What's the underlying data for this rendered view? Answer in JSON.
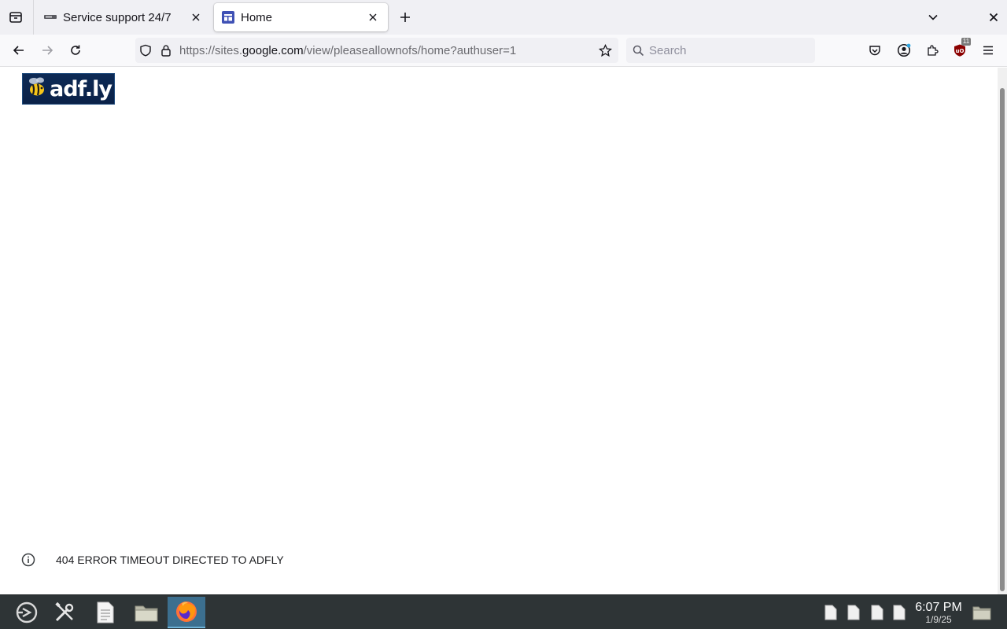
{
  "browser": {
    "tabs": [
      {
        "title": "Service support 24/7",
        "active": false,
        "favicon": "gray-bar-icon"
      },
      {
        "title": "Home",
        "active": true,
        "favicon": "google-sites-icon"
      }
    ],
    "url": {
      "prefix": "https://sites.",
      "domain": "google.com",
      "suffix": "/view/pleaseallownofs/home?authuser=1"
    },
    "search_placeholder": "Search",
    "extension_badge": "11"
  },
  "page": {
    "logo_text": "adf.ly",
    "footer_text": "404 ERROR TIMEOUT DIRECTED TO ADFLY"
  },
  "taskbar": {
    "time": "6:07 PM",
    "date": "1/9/25"
  },
  "colors": {
    "tabstrip_bg": "#f0f0f4",
    "taskbar_bg": "#2e3436",
    "active_task_bg": "#3c6f8f",
    "logo_bg": "#0d2a55"
  }
}
